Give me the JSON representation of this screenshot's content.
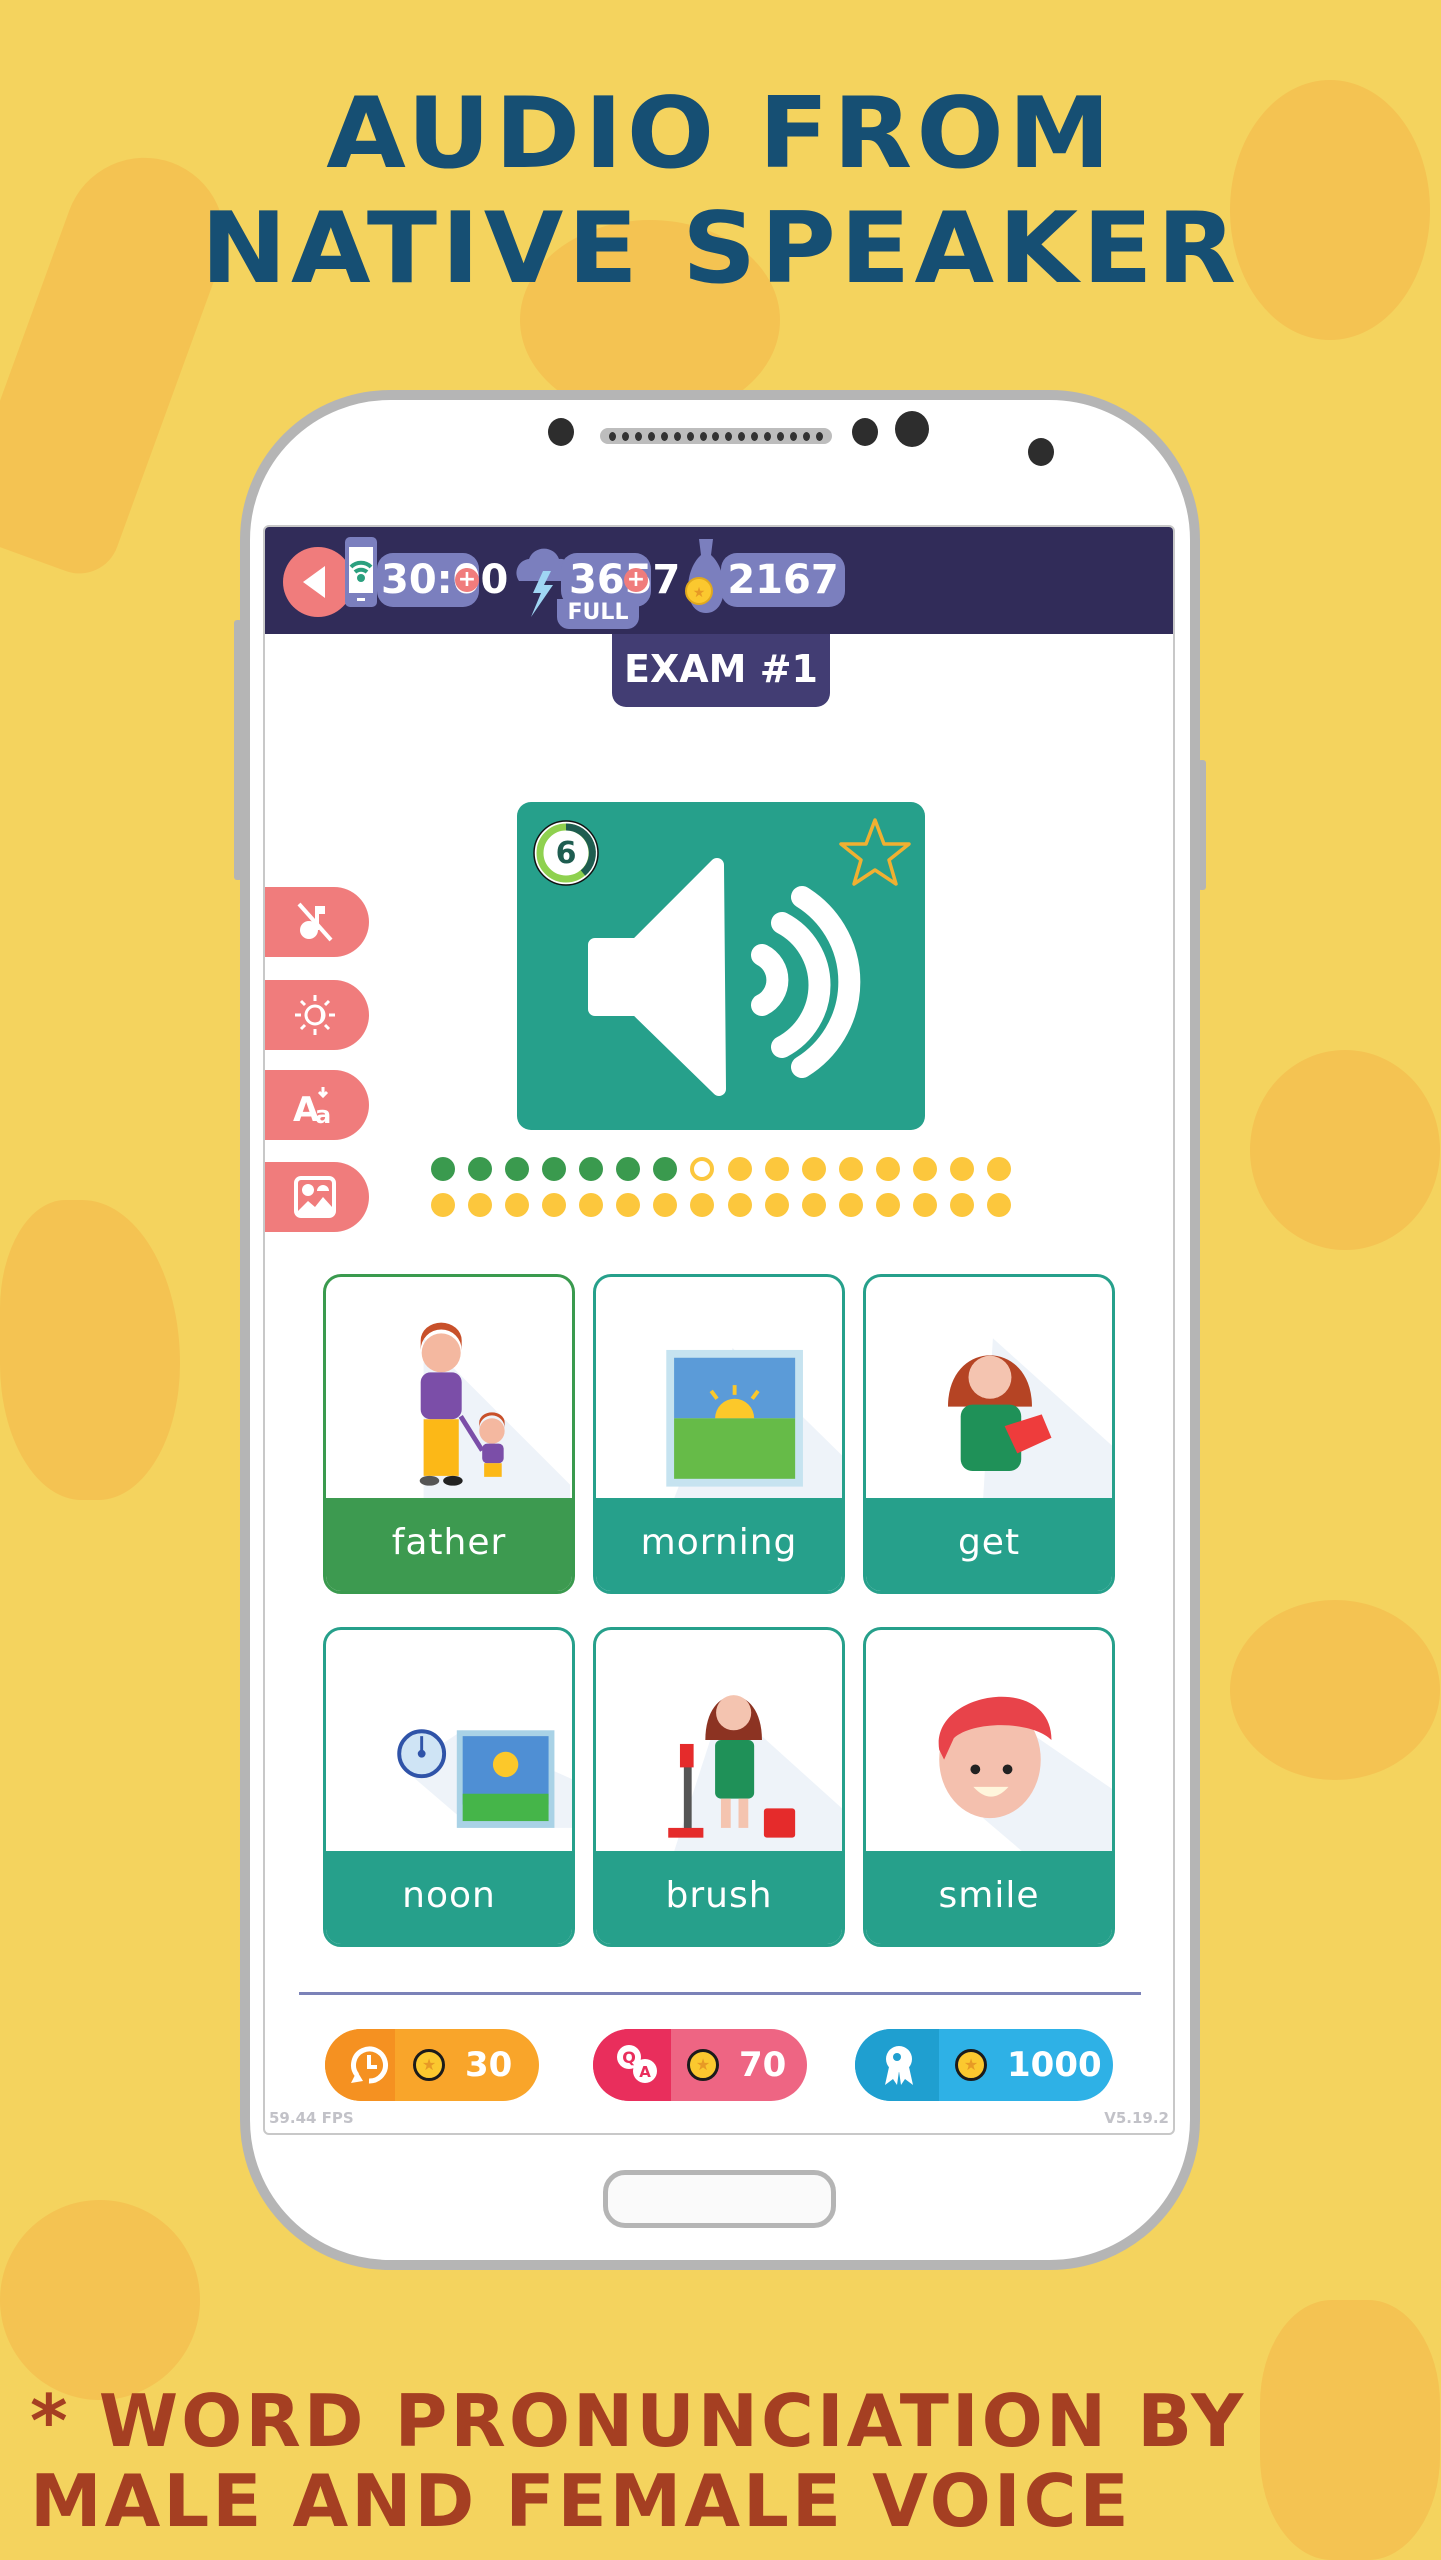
{
  "promo": {
    "headline_line1": "AUDIO FROM",
    "headline_line2": "NATIVE SPEAKER",
    "caption_line1": "* WORD PRONUNCIATION BY",
    "caption_line2": "MALE AND FEMALE VOICE"
  },
  "topbar": {
    "back_icon": "back-arrow-icon",
    "timer": {
      "icon": "phone-wifi-icon",
      "value": "30:00",
      "plus": "+"
    },
    "energy": {
      "icon": "lightning-cloud-icon",
      "value": "3657",
      "plus": "+",
      "status": "FULL"
    },
    "coins": {
      "icon": "money-bag-icon",
      "value": "2167"
    }
  },
  "exam": {
    "title": "EXAM #1"
  },
  "audio_card": {
    "icon": "speaker-icon",
    "countdown": "6",
    "favorite_icon": "star-outline-icon"
  },
  "side_tools": [
    {
      "name": "music-off",
      "icon": "music-off-icon"
    },
    {
      "name": "brightness",
      "icon": "brightness-icon"
    },
    {
      "name": "font-size",
      "icon": "font-size-icon"
    },
    {
      "name": "image-toggle",
      "icon": "image-icon"
    }
  ],
  "progress": {
    "total": 32,
    "completed": 7,
    "current_index": 8,
    "per_row": 16
  },
  "answers": [
    {
      "word": "father",
      "illustration": "father-and-son",
      "selected": true
    },
    {
      "word": "morning",
      "illustration": "sunrise-window",
      "selected": false
    },
    {
      "word": "get",
      "illustration": "girl-with-envelope",
      "selected": false
    },
    {
      "word": "noon",
      "illustration": "clock-and-sun",
      "selected": false
    },
    {
      "word": "brush",
      "illustration": "girl-with-mop-bucket",
      "selected": false
    },
    {
      "word": "smile",
      "illustration": "smiling-face",
      "selected": false
    }
  ],
  "boosters": [
    {
      "name": "extra-time",
      "icon": "clock-rewind-icon",
      "cost": "30"
    },
    {
      "name": "hint",
      "icon": "qa-bubbles-icon",
      "cost": "70"
    },
    {
      "name": "skip",
      "icon": "award-ribbon-icon",
      "cost": "1000"
    }
  ],
  "footer": {
    "fps": "59.44 FPS",
    "version": "V5.19.2"
  },
  "colors": {
    "background": "#f4d35e",
    "headline": "#164f73",
    "caption": "#a53f22",
    "topbar": "#312c59",
    "accent_teal": "#26a08b",
    "correct_green": "#3d9a50",
    "tool_red": "#f07c7c",
    "dot_yellow": "#fcc73d"
  }
}
